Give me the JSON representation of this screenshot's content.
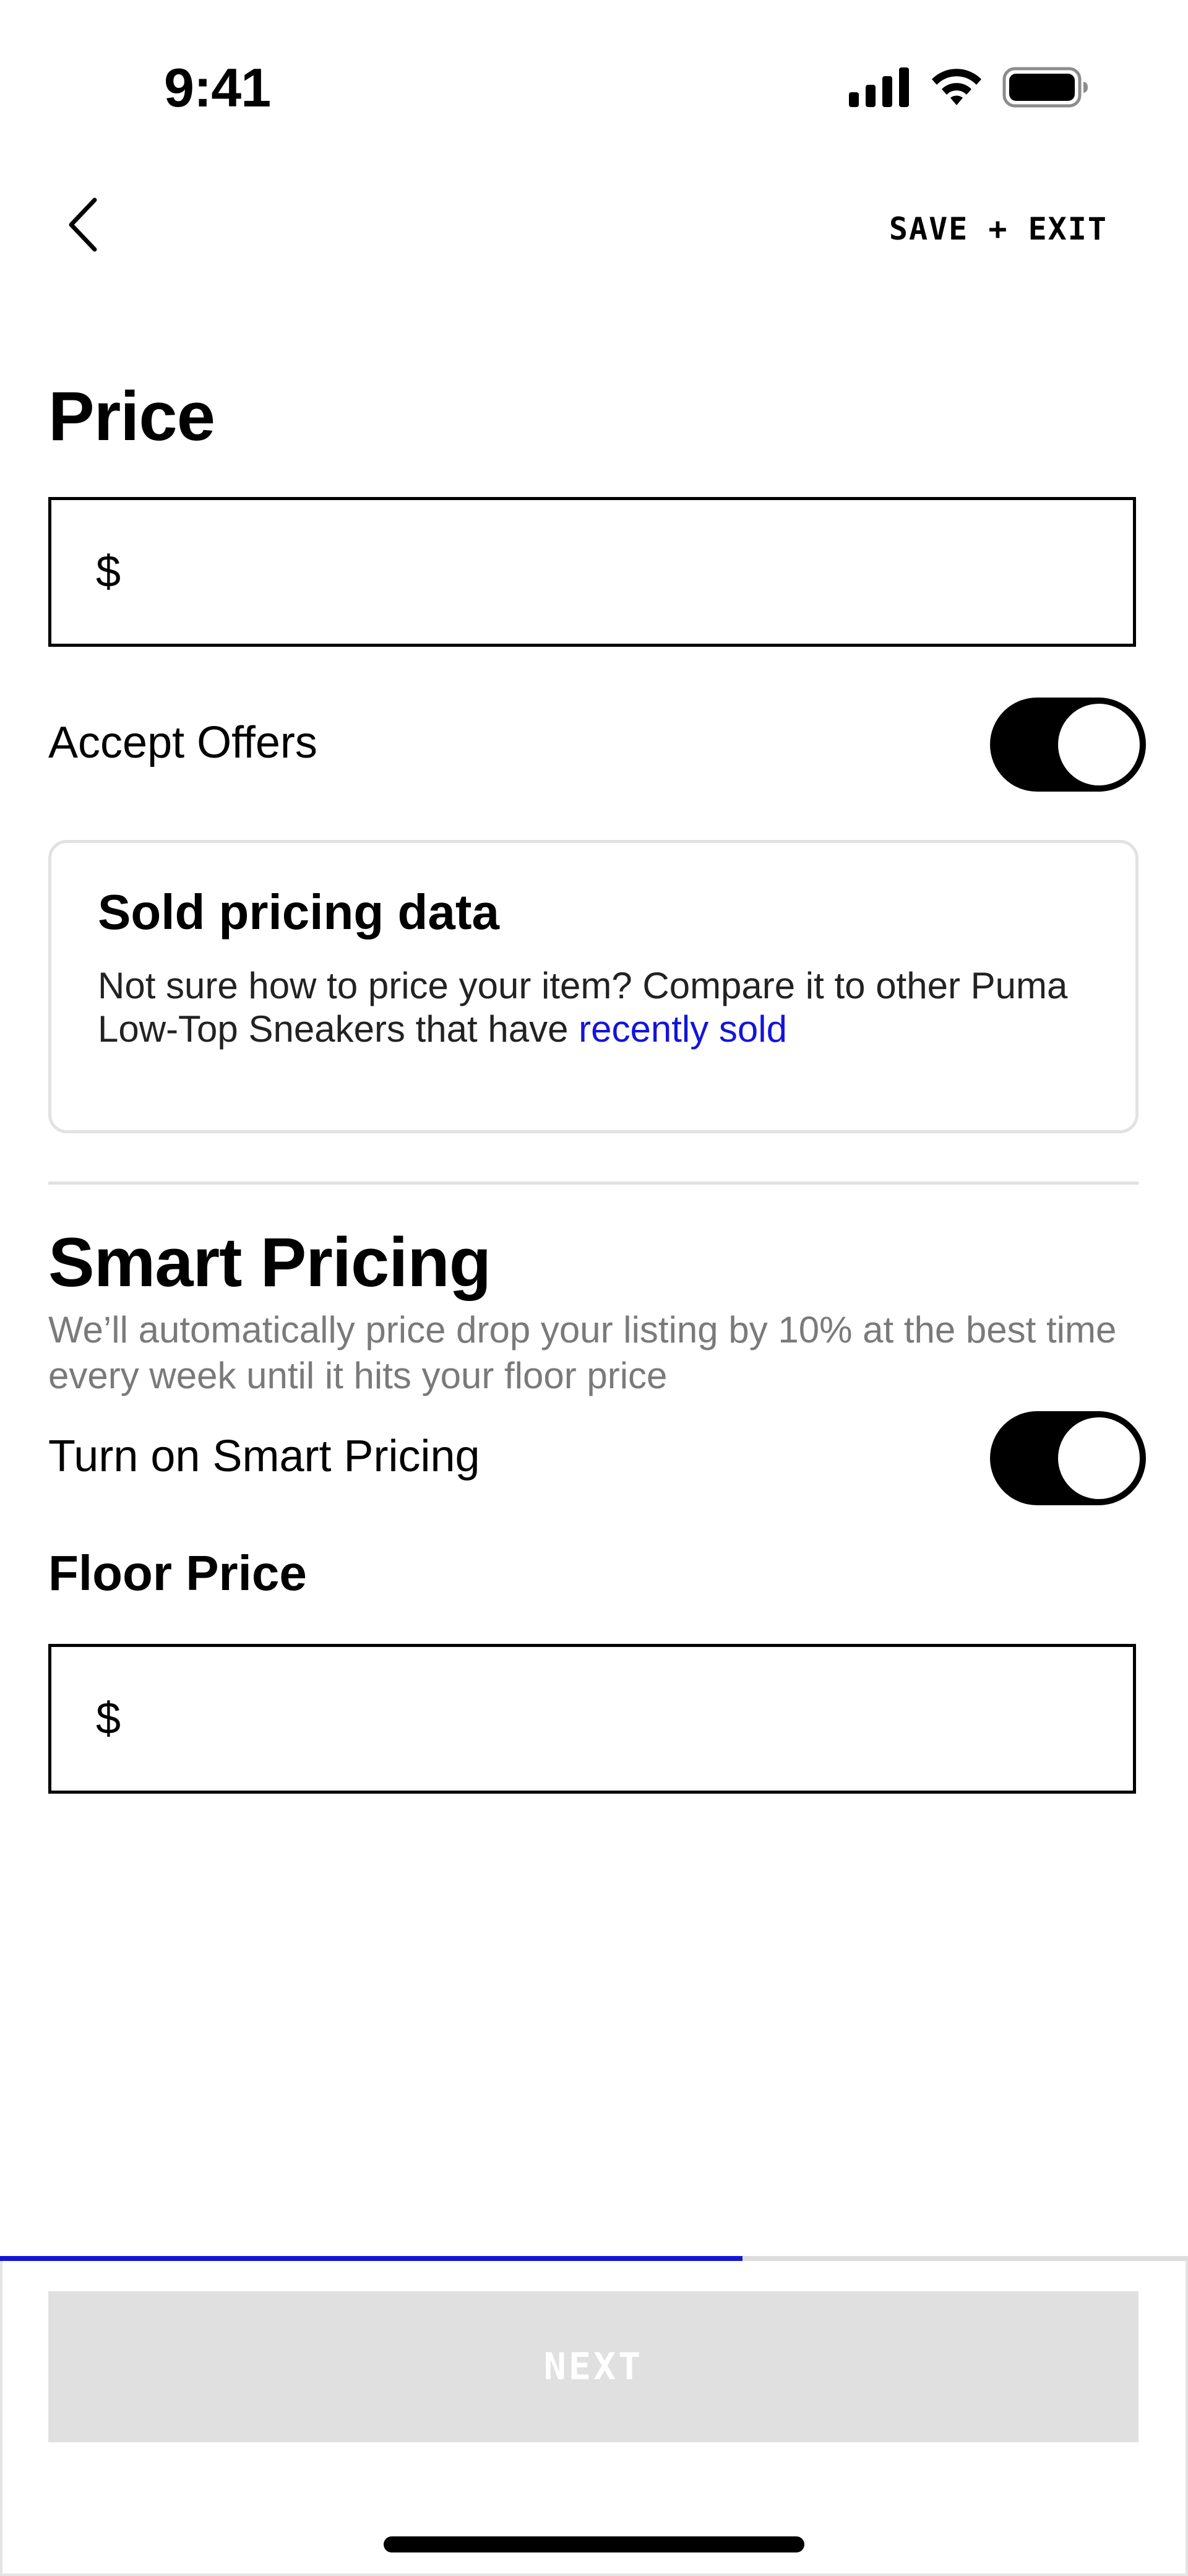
{
  "status_bar": {
    "time": "9:41",
    "icons": [
      "cellular-signal-icon",
      "wifi-icon",
      "battery-icon"
    ]
  },
  "nav": {
    "back_icon": "chevron-left-icon",
    "save_exit_label": "SAVE + EXIT"
  },
  "price": {
    "title": "Price",
    "currency_symbol": "$",
    "value": ""
  },
  "accept_offers": {
    "label": "Accept Offers",
    "enabled": true
  },
  "sold_pricing": {
    "title": "Sold pricing data",
    "body": "Not sure how to price your item? Compare it to other Puma Low-Top Sneakers that have",
    "link_text": "recently sold"
  },
  "smart_pricing": {
    "title": "Smart Pricing",
    "description": "We’ll automatically price drop your listing by 10% at the best time every week until it hits your floor price",
    "toggle_label": "Turn on Smart Pricing",
    "enabled": true
  },
  "floor_price": {
    "title": "Floor Price",
    "currency_symbol": "$",
    "value": ""
  },
  "progress": {
    "fraction": 0.625
  },
  "footer": {
    "next_label": "NEXT",
    "next_enabled": false
  },
  "colors": {
    "accent": "#1414d9",
    "toggle_on": "#000000",
    "disabled_button": "#e0e0e0",
    "muted_text": "#7a7a7a"
  }
}
